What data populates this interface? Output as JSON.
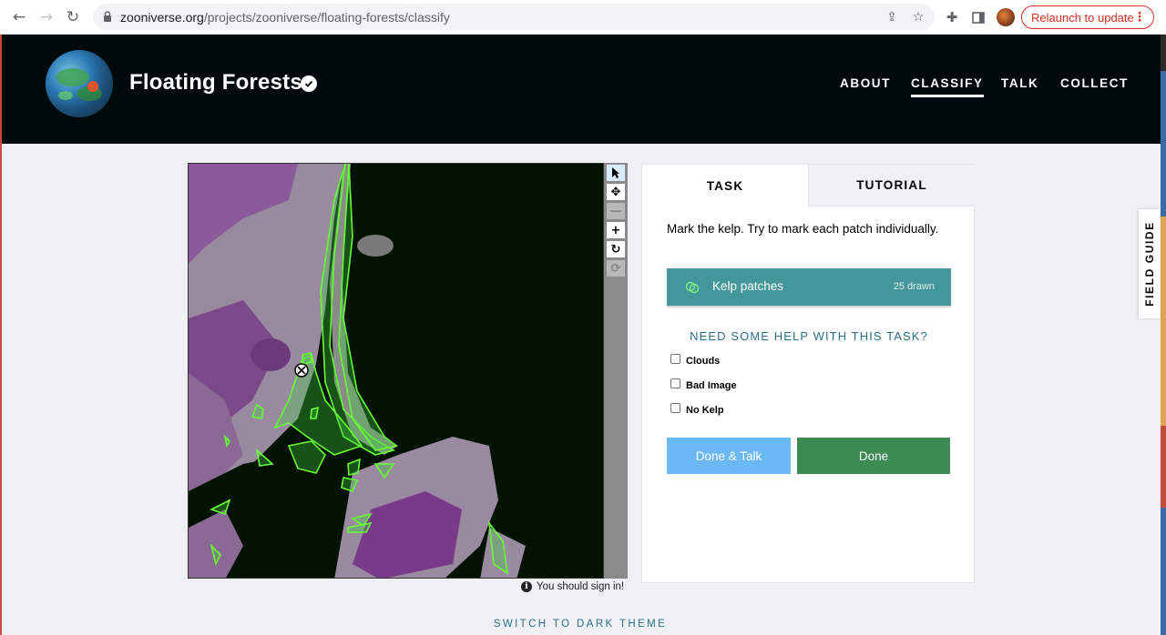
{
  "browser": {
    "url_host": "zooniverse.org",
    "url_path": "/projects/zooniverse/floating-forests/classify",
    "relaunch_label": "Relaunch to update",
    "icons": [
      "back-icon",
      "forward-icon",
      "reload-icon",
      "lock-icon",
      "share-icon",
      "star-icon",
      "extensions-icon",
      "sidepanel-icon",
      "menu-dots-icon"
    ]
  },
  "project": {
    "title": "Floating Forests",
    "nav": [
      {
        "label": "ABOUT",
        "active": false
      },
      {
        "label": "CLASSIFY",
        "active": true
      },
      {
        "label": "TALK",
        "active": false
      },
      {
        "label": "COLLECT",
        "active": false
      }
    ]
  },
  "viewer": {
    "signin_notice": "You should sign in!",
    "tools": [
      "pointer-tool",
      "pan-tool",
      "zoom-out-tool",
      "zoom-in-tool",
      "rotate-tool",
      "reset-tool"
    ]
  },
  "task_panel": {
    "tabs": {
      "task": "TASK",
      "tutorial": "TUTORIAL"
    },
    "instruction": "Mark the kelp. Try to mark each patch individually.",
    "tool_button": {
      "label": "Kelp patches",
      "count": "25 drawn",
      "color": "#43969a"
    },
    "help_heading": "NEED SOME HELP WITH THIS TASK?",
    "checkboxes": [
      "Clouds",
      "Bad Image",
      "No Kelp"
    ],
    "done_talk_label": "Done & Talk",
    "done_label": "Done"
  },
  "field_guide_label": "FIELD GUIDE",
  "footer": {
    "dark_theme_label": "SWITCH TO DARK THEME"
  }
}
